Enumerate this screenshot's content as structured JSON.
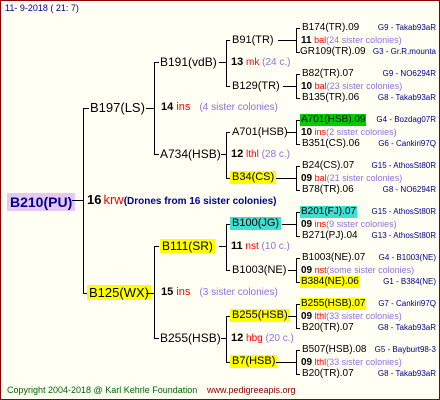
{
  "header": {
    "date": "11-  9-2018 ( 21:  7)"
  },
  "footer": {
    "copyright": "Copyright 2004-2018 @ Karl Kehrle Foundation",
    "site": "www.pedigreeapis.org"
  },
  "colors": {
    "frame_border": "#8b0000",
    "yellow_highlight": "#ffff00",
    "green_highlight": "#00cc00",
    "cyan_highlight": "#40e0d0",
    "root_bg": "#e8c8f0"
  },
  "root": {
    "label": "B210(PU)",
    "num": "16",
    "code": "krw",
    "note": "(Drones from 16 sister colonies)"
  },
  "sire": {
    "label": "B197(LS)",
    "num": "14",
    "code": "ins",
    "note": "(4 sister colonies)"
  },
  "dam": {
    "label": "B125(WX)",
    "num": "15",
    "code": "ins",
    "note": "(3 sister colonies)"
  },
  "ss": {
    "label": "B191(vdB)",
    "num": "13",
    "code": "mk",
    "note": "(24 c.)"
  },
  "sd": {
    "label": "A734(HSB)",
    "num": "12",
    "code": "lthl",
    "note": "(28 c.)"
  },
  "ds": {
    "label": "B111(SR)",
    "num": "11",
    "code": "nst",
    "note": "(10 c.)"
  },
  "dd": {
    "label": "B255(HSB)",
    "num": "12",
    "code": "hbg",
    "note": "(20 c.)"
  },
  "g3": [
    {
      "label": "B91(TR)",
      "num": "11",
      "code": "bal",
      "note": "(24 sister colonies)"
    },
    {
      "label": "B129(TR)",
      "num": "10",
      "code": "bal",
      "note": "(23 sister colonies)"
    },
    {
      "label": "A701(HSB)",
      "num": "10",
      "code": "ins",
      "note": "(2 sister colonies)"
    },
    {
      "label": "B34(CS)",
      "num": "09",
      "code": "bal",
      "note": "(21 sister colonies)"
    },
    {
      "label": "B100(JG)",
      "num": "09",
      "code": "ins",
      "note": "(9 sister colonies)"
    },
    {
      "label": "B1003(NE)",
      "num": "09",
      "code": "nst",
      "note": "(some sister colonies)"
    },
    {
      "label": "B255(HSB)",
      "num": "09",
      "code": "lthl",
      "note": "(33 sister colonies)"
    },
    {
      "label": "B7(HSB)",
      "num": "09",
      "code": "lthl",
      "note": "(33 sister colonies)"
    }
  ],
  "g4": [
    {
      "label": "B174(TR).09",
      "info": "G9 - Takab93aR"
    },
    {
      "label": "GR109(TR).09",
      "info": "G3 - Gr.R.mounta"
    },
    {
      "label": "B82(TR).07",
      "info": "G9 - NO6294R"
    },
    {
      "label": "B135(TR).06",
      "info": "G8 - Takab93aR"
    },
    {
      "label": "A701(HSB).09",
      "info": "G4 - Bozdag07R"
    },
    {
      "label": "B351(CS).06",
      "info": "G6 - Cankiri97Q"
    },
    {
      "label": "B24(CS).07",
      "info": "G15 - AthosSt80R"
    },
    {
      "label": "B78(TR).06",
      "info": "G8 - NO6294R"
    },
    {
      "label": "B201(FJ).07",
      "info": "G15 - AthosSt80R"
    },
    {
      "label": "B271(PJ).04",
      "info": "G13 - AthosSt80R"
    },
    {
      "label": "B1003(NE).07",
      "info": "G4 - B1003(NE)"
    },
    {
      "label": "B384(NE).06",
      "info": "G1 - B384(NE)"
    },
    {
      "label": "B255(HSB).07",
      "info": "G7 - Cankiri97Q"
    },
    {
      "label": "B20(TR).07",
      "info": "G8 - Takab93aR"
    },
    {
      "label": "B507(HSB).08",
      "info": "G5 - Bayburt98-3"
    },
    {
      "label": "B20(TR).07",
      "info": "G8 - Takab93aR"
    }
  ]
}
